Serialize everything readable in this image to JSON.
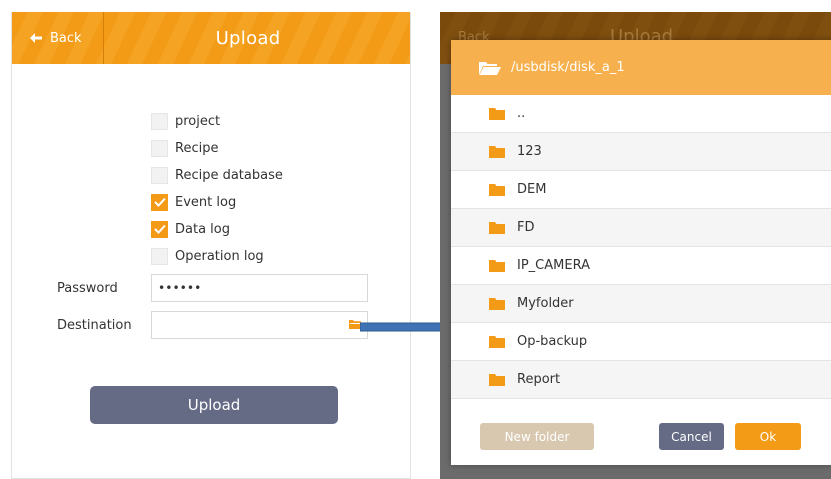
{
  "left": {
    "header": {
      "back_label": "Back",
      "title": "Upload"
    },
    "options": [
      {
        "label": "project",
        "checked": false
      },
      {
        "label": "Recipe",
        "checked": false
      },
      {
        "label": "Recipe database",
        "checked": false
      },
      {
        "label": "Event log",
        "checked": true
      },
      {
        "label": "Data log",
        "checked": true
      },
      {
        "label": "Operation log",
        "checked": false
      }
    ],
    "password": {
      "label": "Password",
      "value": "••••••"
    },
    "destination": {
      "label": "Destination",
      "value": ""
    },
    "upload_button": "Upload"
  },
  "right": {
    "header": {
      "back_label": "Back",
      "title": "Upload"
    },
    "dialog": {
      "path": "/usbdisk/disk_a_1",
      "folders": [
        "..",
        "123",
        "DEM",
        "FD",
        "IP_CAMERA",
        "Myfolder",
        "Op-backup",
        "Report"
      ],
      "new_folder_button": "New folder",
      "cancel_button": "Cancel",
      "ok_button": "Ok"
    }
  },
  "colors": {
    "accent": "#f39a16",
    "dialog_header": "#f7b04e",
    "upload_button": "#656a85",
    "new_folder_button": "#d9c8b0",
    "cancel_button": "#656a85",
    "ok_button": "#f39a16",
    "arrow": "#3f73b4"
  }
}
